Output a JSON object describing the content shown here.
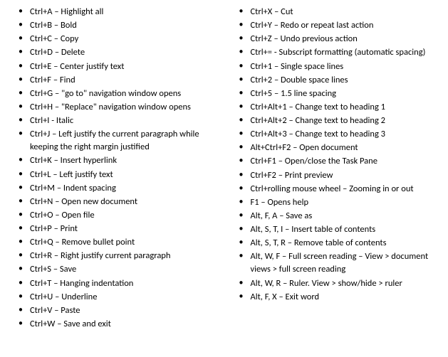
{
  "shortcuts": {
    "col1": [
      "Ctrl+A – Highlight all",
      "Ctrl+B – Bold",
      "Ctrl+C – Copy",
      "Ctrl+D – Delete",
      "Ctrl+E – Center justify text",
      "Ctrl+F – Find",
      "Ctrl+G – \"go to\" navigation window opens",
      "Ctrl+H – \"Replace\" navigation window opens",
      "Ctrl+I - Italic",
      "Ctrl+J – Left justify the current paragraph while keeping the right margin justified",
      "Ctrl+K – Insert hyperlink",
      "Ctrl+L – Left justify text",
      "Ctrl+M – Indent spacing",
      "Ctrl+N – Open new document",
      "Ctrl+O – Open file",
      "Ctrl+P – Print",
      "Ctrl+Q – Remove bullet point",
      "Ctrl+R – Right justify current paragraph",
      "Ctrl+S – Save",
      "Ctrl+T – Hanging indentation",
      "Ctrl+U – Underline",
      "Ctrl+V – Paste",
      "Ctrl+W – Save and exit"
    ],
    "col2": [
      "Ctrl+X – Cut",
      "Ctrl+Y – Redo or repeat last action",
      "Ctrl+Z – Undo previous action",
      "Ctrl+= - Subscript formatting (automatic spacing)",
      "Ctrl+1 – Single space lines",
      "Ctrl+2 – Double space lines",
      "Ctrl+5 – 1.5 line spacing",
      "Ctrl+Alt+1 – Change text to heading 1",
      "Ctrl+Alt+2 – Change text to heading 2",
      "Ctrl+Alt+3 – Change text to heading 3",
      "Alt+Ctrl+F2 – Open document",
      "Ctrl+F1 – Open/close the Task Pane",
      "Ctrl+F2 – Print preview",
      "Ctrl+rolling mouse wheel – Zooming in or out",
      "F1 – Opens help",
      "Alt, F, A – Save as",
      "Alt, S, T, I – Insert table of contents",
      "Alt, S, T, R – Remove table of contents",
      "Alt, W, F – Full screen reading – View > document views > full screen reading",
      "Alt, W, R – Ruler. View > show/hide > ruler",
      "Alt, F, X – Exit word"
    ]
  }
}
